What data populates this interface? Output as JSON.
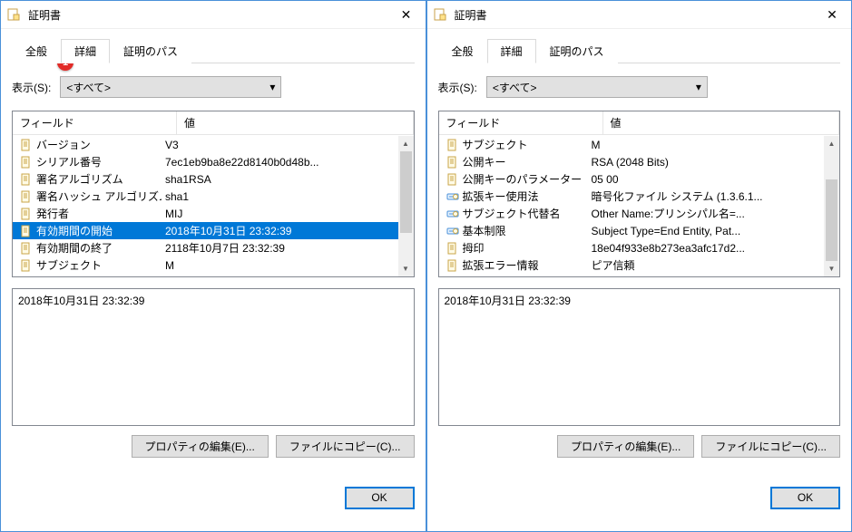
{
  "windows": [
    {
      "title": "証明書",
      "tabs": {
        "general": "全般",
        "details": "詳細",
        "certpath": "証明のパス",
        "active_index": 1
      },
      "show": {
        "label": "表示(S):",
        "selected": "<すべて>"
      },
      "cols": {
        "field": "フィールド",
        "value": "値"
      },
      "rows": [
        {
          "icon": "doc",
          "field": "バージョン",
          "value": "V3"
        },
        {
          "icon": "doc",
          "field": "シリアル番号",
          "value": "7ec1eb9ba8e22d8140b0d48b..."
        },
        {
          "icon": "doc",
          "field": "署名アルゴリズム",
          "value": "sha1RSA"
        },
        {
          "icon": "doc",
          "field": "署名ハッシュ アルゴリズム",
          "value": "sha1"
        },
        {
          "icon": "doc",
          "field": "発行者",
          "value": "MIJ"
        },
        {
          "icon": "doc",
          "field": "有効期間の開始",
          "value": "2018年10月31日 23:32:39",
          "selected": true
        },
        {
          "icon": "doc",
          "field": "有効期間の終了",
          "value": "2118年10月7日 23:32:39"
        },
        {
          "icon": "doc",
          "field": "サブジェクト",
          "value": "M"
        }
      ],
      "detail": "2018年10月31日 23:32:39",
      "buttons": {
        "edit": "プロパティの編集(E)...",
        "copy": "ファイルにコピー(C)..."
      },
      "ok": "OK",
      "badge": "1"
    },
    {
      "title": "証明書",
      "tabs": {
        "general": "全般",
        "details": "詳細",
        "certpath": "証明のパス",
        "active_index": 1
      },
      "show": {
        "label": "表示(S):",
        "selected": "<すべて>"
      },
      "cols": {
        "field": "フィールド",
        "value": "値"
      },
      "rows": [
        {
          "icon": "doc",
          "field": "サブジェクト",
          "value": "M"
        },
        {
          "icon": "doc",
          "field": "公開キー",
          "value": "RSA (2048 Bits)"
        },
        {
          "icon": "doc",
          "field": "公開キーのパラメーター",
          "value": "05 00"
        },
        {
          "icon": "ext",
          "field": "拡張キー使用法",
          "value": "暗号化ファイル システム (1.3.6.1..."
        },
        {
          "icon": "ext",
          "field": "サブジェクト代替名",
          "value": "Other Name:プリンシパル名=..."
        },
        {
          "icon": "ext",
          "field": "基本制限",
          "value": "Subject Type=End Entity, Pat..."
        },
        {
          "icon": "doc",
          "field": "拇印",
          "value": "18e04f933e8b273ea3afc17d2..."
        },
        {
          "icon": "doc",
          "field": "拡張エラー情報",
          "value": "ピア信頼"
        }
      ],
      "detail": "2018年10月31日 23:32:39",
      "buttons": {
        "edit": "プロパティの編集(E)...",
        "copy": "ファイルにコピー(C)..."
      },
      "ok": "OK",
      "scroll_thumb_bottom": true
    }
  ]
}
